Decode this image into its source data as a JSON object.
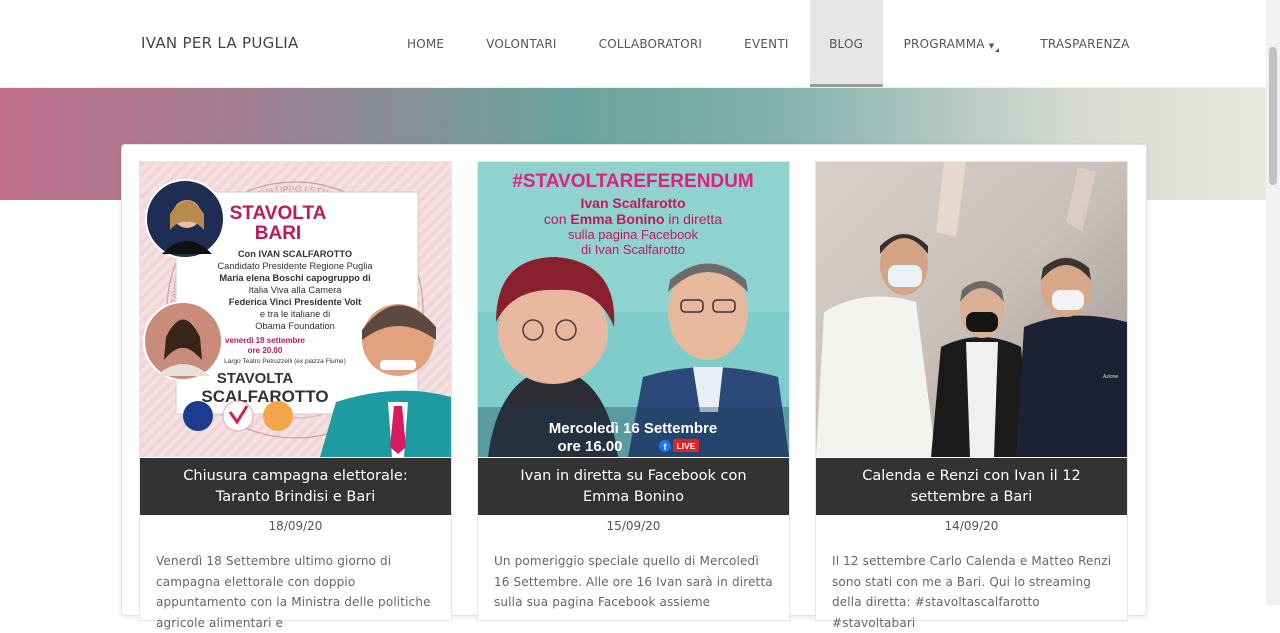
{
  "site": {
    "brand": "IVAN PER LA PUGLIA"
  },
  "nav": {
    "items": [
      {
        "label": "HOME"
      },
      {
        "label": "VOLONTARI"
      },
      {
        "label": "COLLABORATORI"
      },
      {
        "label": "EVENTI"
      },
      {
        "label": "BLOG",
        "active": true
      },
      {
        "label": "PROGRAMMA",
        "dropdown": true
      },
      {
        "label": "TRASPARENZA"
      }
    ],
    "dropdown_icon": "chevron-down-icon"
  },
  "colors": {
    "header_bg": "#ffffff",
    "active_nav_bg": "#e6e6e6",
    "card_title_bg": "#333333",
    "banner_gradient": [
      "#c0708d",
      "#6aa39d",
      "#eae8e0"
    ]
  },
  "posts": [
    {
      "title": "Chiusura campagna elettorale: Taranto Brindisi e Bari",
      "date": "18/09/20",
      "excerpt": "Venerdì 18 Settembre ultimo giorno di campagna elettorale con doppio appuntamento con la Ministra delle politiche agricole alimentari e",
      "image": {
        "headline": "STAVOLTA BARI",
        "lines": [
          "Con IVAN SCALFAROTTO",
          "Candidato Presidente Regione Puglia",
          "Maria elena Boschi capogruppo di",
          "Italia Viva alla Camera",
          "Federica Vinci Presidente Volt",
          "e tra le italiane di",
          "Obama Foundation"
        ],
        "when": "venerdì 18 settembre",
        "time": "ore 20.00",
        "place": "Largo Teatro Petruzzelli (ex piazza Fiume)",
        "footer_top": "STAVOLTA",
        "footer_bottom": "SCALFAROTTO",
        "ring_text": "STAVOLTA | GIOVANI | STAVOLTA | SVILUPPO | STAVOLTA | FUTURO |"
      }
    },
    {
      "title": "Ivan in diretta su Facebook con Emma Bonino",
      "date": "15/09/20",
      "excerpt": "Un pomeriggio speciale quello di Mercoledì 16 Settembre. Alle ore 16 Ivan sarà in diretta sulla sua pagina Facebook assieme",
      "image": {
        "hashtag": "#STAVOLTAREFERENDUM",
        "line1": "Ivan Scalfarotto",
        "line2_a": "con ",
        "line2_b": "Emma Bonino",
        "line2_c": " in diretta",
        "line3": "sulla pagina Facebook",
        "line4": "di Ivan Scalfarotto",
        "day": "Mercoledì 16 Settembre",
        "time": "ore 16.00",
        "live_badge": "LIVE"
      }
    },
    {
      "title": "Calenda e Renzi con Ivan il 12 settembre a Bari",
      "date": "14/09/20",
      "excerpt": "Il 12 settembre Carlo Calenda e Matteo Renzi sono stati con me a Bari. Qui lo streaming della diretta: #stavoltascalfarotto #stavoltabari",
      "image": {
        "shirt_text": "Azione"
      }
    }
  ]
}
